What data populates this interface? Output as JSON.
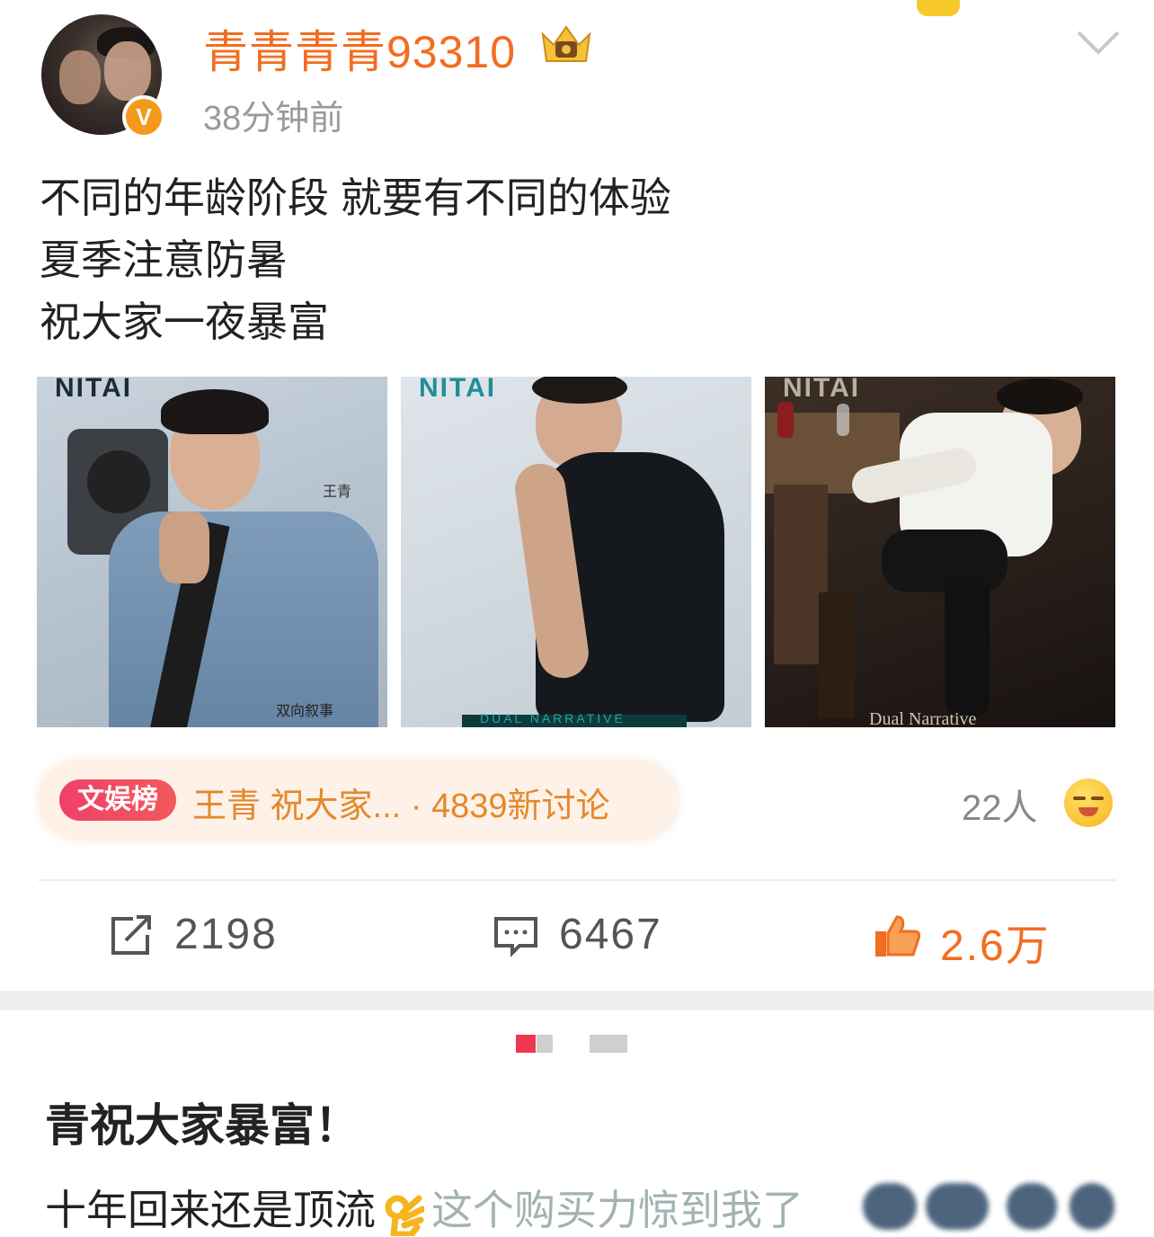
{
  "post": {
    "username": "青青青青93310",
    "time_ago": "38分钟前",
    "verified_badge": "V",
    "text_lines": [
      "不同的年龄阶段 就要有不同的体验",
      "夏季注意防暑",
      "祝大家一夜暴富"
    ],
    "images": [
      {
        "magazine_mark": "NITAI",
        "caption_a": "王青",
        "caption_b": "双向叙事"
      },
      {
        "magazine_mark": "NITAI",
        "caption_a": "DUAL NARRATIVE"
      },
      {
        "magazine_mark": "NITAI",
        "caption_a": "Dual Narrative"
      }
    ]
  },
  "topic": {
    "badge": "文娱榜",
    "title": "王青 祝大家... · 4839新讨论",
    "people": "22人"
  },
  "actions": {
    "repost_count": "2198",
    "comment_count": "6467",
    "like_count": "2.6万"
  },
  "article": {
    "headline": "青祝大家暴富！",
    "body_before_emoji": "十年回来还是顶流",
    "body_after_emoji": "这个购买力惊到我了"
  },
  "icons": [
    "avatar",
    "verified-badge-icon",
    "crown-icon",
    "chevron-down-icon",
    "repost-icon",
    "comment-icon",
    "like-icon",
    "emoji-icon",
    "ok-hand-icon"
  ],
  "colors": {
    "username": "#f26d22",
    "like": "#f26d22",
    "topic_badge": "#f0406a",
    "topic_text": "#e3892b",
    "page_indicator_active": "#f2364f"
  }
}
